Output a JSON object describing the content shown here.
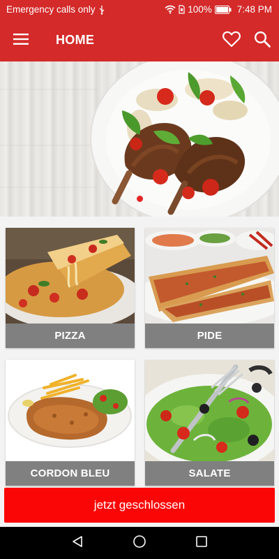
{
  "status_bar": {
    "carrier_text": "Emergency calls only",
    "battery_percent": "100%",
    "time": "7:48 PM",
    "icons": [
      "usb-icon",
      "wifi-icon",
      "sim-icon",
      "battery-icon"
    ]
  },
  "app_bar": {
    "title": "HOME",
    "icons": [
      "menu-icon",
      "heart-icon",
      "search-icon"
    ],
    "color": "#d42a2a"
  },
  "banner": {
    "active_slide": 1,
    "indicator_color": "#e52424"
  },
  "categories": [
    {
      "label": "PIZZA"
    },
    {
      "label": "PIDE"
    },
    {
      "label": "CORDON BLEU"
    },
    {
      "label": "SALATE"
    }
  ],
  "label_color": "#808080",
  "closed_button": {
    "label": "jetzt geschlossen",
    "color": "#fb0606"
  },
  "nav_bar": {
    "icons": [
      "back-icon",
      "home-icon",
      "recents-icon"
    ]
  }
}
